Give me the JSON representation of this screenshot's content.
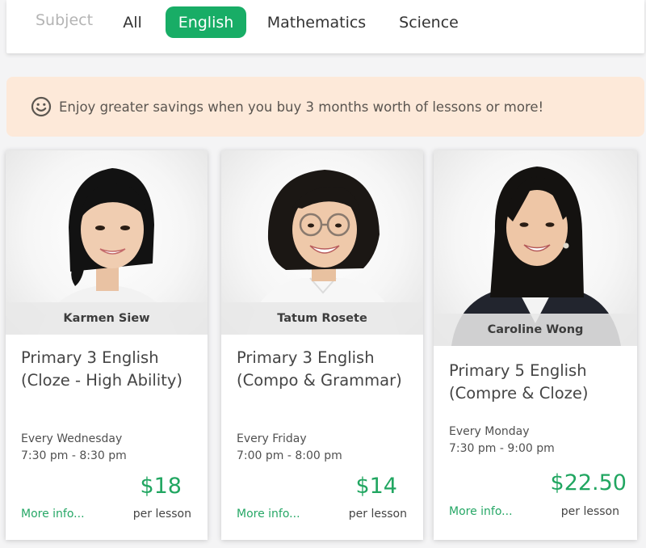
{
  "filter": {
    "label": "Subject",
    "tabs": [
      "All",
      "English",
      "Mathematics",
      "Science"
    ],
    "active": "English",
    "active_color": "#18ad66"
  },
  "promo": {
    "icon": "smile-icon",
    "text": "Enjoy greater savings when you buy 3 months worth of lessons or more!",
    "background": "#fde9d9"
  },
  "cards": [
    {
      "teacher": "Karmen Siew",
      "course_line1": "Primary 3 English",
      "course_line2": "(Cloze - High Ability)",
      "day": "Every Wednesday",
      "time": "7:30 pm - 8:30 pm",
      "price": "$18",
      "more": "More info...",
      "per": "per lesson"
    },
    {
      "teacher": "Tatum Rosete",
      "course_line1": "Primary 3 English",
      "course_line2": "(Compo & Grammar)",
      "day": "Every Friday",
      "time": "7:00 pm - 8:00 pm",
      "price": "$14",
      "more": "More info...",
      "per": "per lesson"
    },
    {
      "teacher": "Caroline Wong",
      "course_line1": "Primary 5 English",
      "course_line2": "(Compre & Cloze)",
      "day": "Every Monday",
      "time": "7:30 pm - 9:00 pm",
      "price": "$22.50",
      "more": "More info...",
      "per": "per lesson"
    }
  ],
  "colors": {
    "price": "#21a661",
    "link": "#26a766"
  }
}
